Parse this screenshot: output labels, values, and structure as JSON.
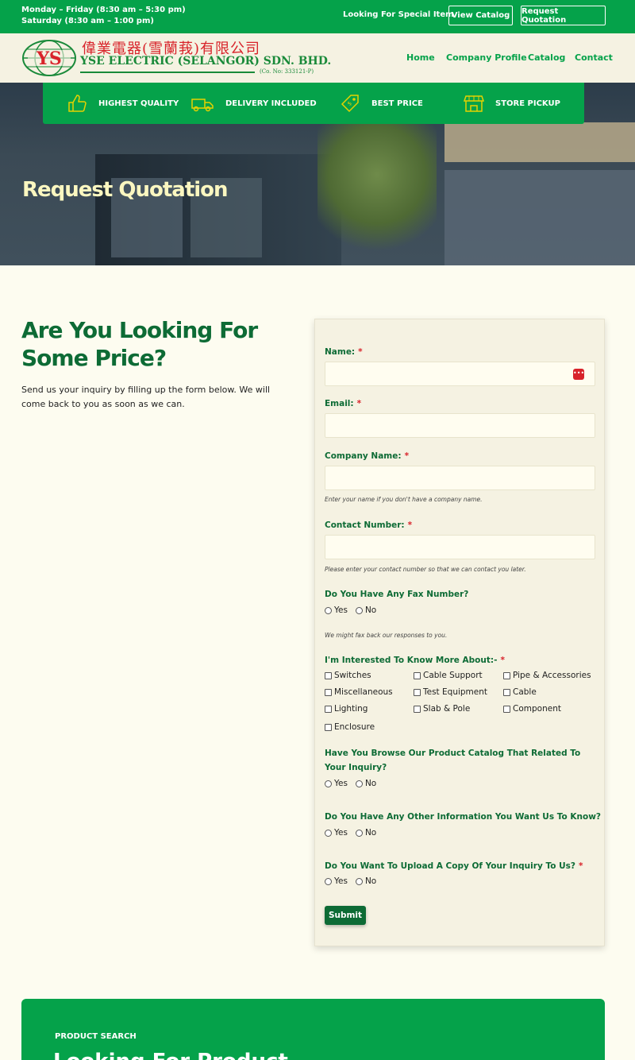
{
  "topbar": {
    "hours_line1": "Monday – Friday (8:30 am – 5:30 pm)",
    "hours_line2": "Saturday (8:30 am – 1:00 pm)",
    "special_text": "Looking For Special Item",
    "catalog_button": "View Catalog",
    "quotation_button": "Request Quotation"
  },
  "brand": {
    "logo_letters": "YS",
    "chinese_name": "偉業電器(雪蘭莪)有限公司",
    "english_name": "YSE ELECTRIC (SELANGOR) SDN. BHD.",
    "company_no": "(Co. No: 333121-P)",
    "logo_red": "#d8232a",
    "logo_green": "#1a8a3a"
  },
  "nav": {
    "items": [
      "Home",
      "Company Profile",
      "Catalog",
      "Contact"
    ]
  },
  "features": [
    {
      "icon": "thumbs-up-icon",
      "label": "HIGHEST QUALITY"
    },
    {
      "icon": "delivery-truck-icon",
      "label": "DELIVERY INCLUDED"
    },
    {
      "icon": "price-tag-icon",
      "label": "BEST PRICE"
    },
    {
      "icon": "storefront-icon",
      "label": "STORE PICKUP"
    }
  ],
  "hero": {
    "title": "Request Quotation"
  },
  "intro": {
    "heading": "Are You Looking For Some Price?",
    "text": "Send us your inquiry by filling up the form below. We will come back to you as soon as we can."
  },
  "form": {
    "name_label": "Name:",
    "email_label": "Email:",
    "company_label": "Company Name:",
    "company_hint": "Enter your name if you don't have a company name.",
    "contact_label": "Contact Number:",
    "contact_hint": "Please enter your contact number so that we can contact you later.",
    "fax_label": "Do You Have Any Fax Number?",
    "fax_hint": "We might fax back our responses to you.",
    "interest_label": "I'm Interested To Know More About:-",
    "interests": [
      "Switches",
      "Cable Support",
      "Pipe & Accessories",
      "Miscellaneous",
      "Test Equipment",
      "Cable",
      "Lighting",
      "Slab & Pole",
      "Component",
      "Enclosure"
    ],
    "catalog_q": "Have You Browse Our Product Catalog That Related To Your Inquiry?",
    "other_info_q": "Do You Have Any Other Information You Want Us To Know?",
    "upload_q": "Do You Want To Upload A Copy Of Your Inquiry To Us?",
    "yes": "Yes",
    "no": "No",
    "required_mark": "*",
    "submit_label": "Submit"
  },
  "bottom": {
    "kicker": "PRODUCT SEARCH",
    "title": "Looking For Product"
  },
  "colors": {
    "primary_green": "#05a24a",
    "dark_green": "#0d6b35",
    "required_red": "#d8232a",
    "hero_title": "#fbf7c0"
  }
}
